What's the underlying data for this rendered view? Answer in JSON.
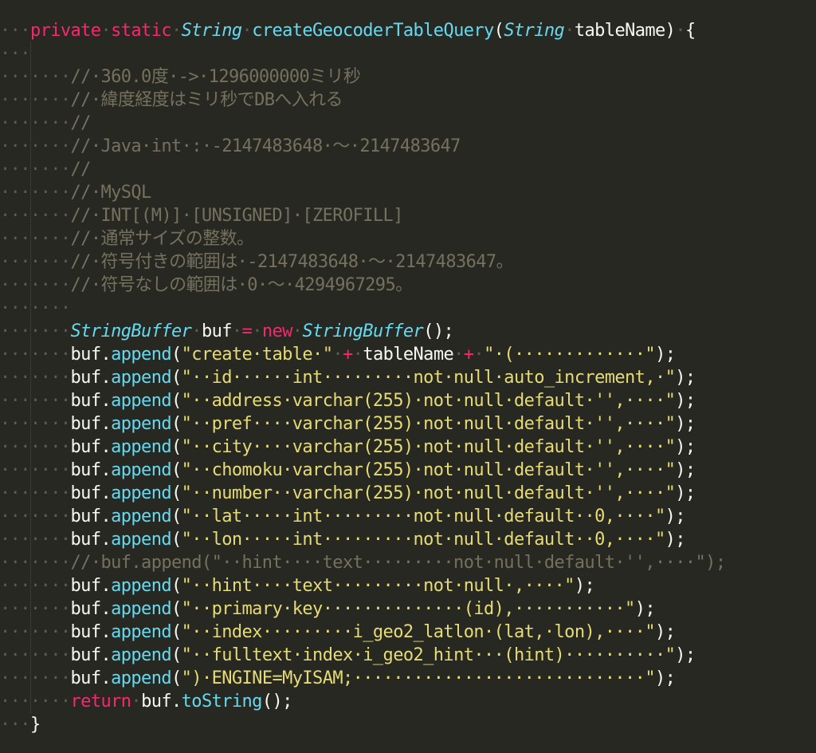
{
  "theme": {
    "background": "#272822",
    "foreground": "#F8F8F2",
    "keyword": "#F92672",
    "type": "#66D9EF",
    "function": "#A6E22E",
    "string": "#E6DB74",
    "comment": "#75715E",
    "whitespace_marker": "#5b5c52"
  },
  "editor": {
    "lines": [
      {
        "indent": "···",
        "tokens": [
          {
            "t": "private",
            "c": "keyword"
          },
          {
            "t": "·",
            "c": "ws"
          },
          {
            "t": "static",
            "c": "keyword"
          },
          {
            "t": "·",
            "c": "ws"
          },
          {
            "t": "String",
            "c": "type"
          },
          {
            "t": "·",
            "c": "ws"
          },
          {
            "t": "createGeocoderTableQuery",
            "c": "call"
          },
          {
            "t": "(",
            "c": "punct"
          },
          {
            "t": "String",
            "c": "type"
          },
          {
            "t": "·",
            "c": "ws"
          },
          {
            "t": "tableName",
            "c": "plain"
          },
          {
            "t": ")",
            "c": "punct"
          },
          {
            "t": "·",
            "c": "ws"
          },
          {
            "t": "{",
            "c": "punct"
          }
        ]
      },
      {
        "indent": "···",
        "tokens": []
      },
      {
        "indent": "·······",
        "tokens": [
          {
            "t": "//·360.0度·->·1296000000ミリ秒",
            "c": "comment"
          }
        ]
      },
      {
        "indent": "·······",
        "tokens": [
          {
            "t": "//·緯度経度はミリ秒でDBへ入れる",
            "c": "comment"
          }
        ]
      },
      {
        "indent": "·······",
        "tokens": [
          {
            "t": "//",
            "c": "comment"
          }
        ]
      },
      {
        "indent": "·······",
        "tokens": [
          {
            "t": "//·Java·int·:·-2147483648·〜·2147483647",
            "c": "comment"
          }
        ]
      },
      {
        "indent": "·······",
        "tokens": [
          {
            "t": "//",
            "c": "comment"
          }
        ]
      },
      {
        "indent": "·······",
        "tokens": [
          {
            "t": "//·MySQL",
            "c": "comment"
          }
        ]
      },
      {
        "indent": "·······",
        "tokens": [
          {
            "t": "//·INT[(M)]·[UNSIGNED]·[ZEROFILL]",
            "c": "comment"
          }
        ]
      },
      {
        "indent": "·······",
        "tokens": [
          {
            "t": "//·通常サイズの整数。",
            "c": "comment"
          }
        ]
      },
      {
        "indent": "·······",
        "tokens": [
          {
            "t": "//·符号付きの範囲は·-2147483648·〜·2147483647。",
            "c": "comment"
          }
        ]
      },
      {
        "indent": "·······",
        "tokens": [
          {
            "t": "//·符号なしの範囲は·0·〜·4294967295。",
            "c": "comment"
          }
        ]
      },
      {
        "indent": "·······",
        "tokens": []
      },
      {
        "indent": "·······",
        "tokens": [
          {
            "t": "StringBuffer",
            "c": "type"
          },
          {
            "t": "·",
            "c": "ws"
          },
          {
            "t": "buf",
            "c": "plain"
          },
          {
            "t": "·",
            "c": "ws"
          },
          {
            "t": "=",
            "c": "op"
          },
          {
            "t": "·",
            "c": "ws"
          },
          {
            "t": "new",
            "c": "keyword"
          },
          {
            "t": "·",
            "c": "ws"
          },
          {
            "t": "StringBuffer",
            "c": "type"
          },
          {
            "t": "();",
            "c": "punct"
          }
        ]
      },
      {
        "indent": "·······",
        "tokens": [
          {
            "t": "buf.",
            "c": "plain"
          },
          {
            "t": "append",
            "c": "call"
          },
          {
            "t": "(",
            "c": "punct"
          },
          {
            "t": "\"create·table·\"",
            "c": "string"
          },
          {
            "t": "·",
            "c": "ws"
          },
          {
            "t": "+",
            "c": "op"
          },
          {
            "t": "·",
            "c": "ws"
          },
          {
            "t": "tableName",
            "c": "plain"
          },
          {
            "t": "·",
            "c": "ws"
          },
          {
            "t": "+",
            "c": "op"
          },
          {
            "t": "·",
            "c": "ws"
          },
          {
            "t": "\"·(·············\"",
            "c": "string"
          },
          {
            "t": ");",
            "c": "punct"
          }
        ]
      },
      {
        "indent": "·······",
        "tokens": [
          {
            "t": "buf.",
            "c": "plain"
          },
          {
            "t": "append",
            "c": "call"
          },
          {
            "t": "(",
            "c": "punct"
          },
          {
            "t": "\"··id······int·········not·null·auto_increment,·\"",
            "c": "string"
          },
          {
            "t": ");",
            "c": "punct"
          }
        ]
      },
      {
        "indent": "·······",
        "tokens": [
          {
            "t": "buf.",
            "c": "plain"
          },
          {
            "t": "append",
            "c": "call"
          },
          {
            "t": "(",
            "c": "punct"
          },
          {
            "t": "\"··address·varchar(255)·not·null·default·'',····\"",
            "c": "string"
          },
          {
            "t": ");",
            "c": "punct"
          }
        ]
      },
      {
        "indent": "·······",
        "tokens": [
          {
            "t": "buf.",
            "c": "plain"
          },
          {
            "t": "append",
            "c": "call"
          },
          {
            "t": "(",
            "c": "punct"
          },
          {
            "t": "\"··pref····varchar(255)·not·null·default·'',····\"",
            "c": "string"
          },
          {
            "t": ");",
            "c": "punct"
          }
        ]
      },
      {
        "indent": "·······",
        "tokens": [
          {
            "t": "buf.",
            "c": "plain"
          },
          {
            "t": "append",
            "c": "call"
          },
          {
            "t": "(",
            "c": "punct"
          },
          {
            "t": "\"··city····varchar(255)·not·null·default·'',····\"",
            "c": "string"
          },
          {
            "t": ");",
            "c": "punct"
          }
        ]
      },
      {
        "indent": "·······",
        "tokens": [
          {
            "t": "buf.",
            "c": "plain"
          },
          {
            "t": "append",
            "c": "call"
          },
          {
            "t": "(",
            "c": "punct"
          },
          {
            "t": "\"··chomoku·varchar(255)·not·null·default·'',····\"",
            "c": "string"
          },
          {
            "t": ");",
            "c": "punct"
          }
        ]
      },
      {
        "indent": "·······",
        "tokens": [
          {
            "t": "buf.",
            "c": "plain"
          },
          {
            "t": "append",
            "c": "call"
          },
          {
            "t": "(",
            "c": "punct"
          },
          {
            "t": "\"··number··varchar(255)·not·null·default·'',····\"",
            "c": "string"
          },
          {
            "t": ");",
            "c": "punct"
          }
        ]
      },
      {
        "indent": "·······",
        "tokens": [
          {
            "t": "buf.",
            "c": "plain"
          },
          {
            "t": "append",
            "c": "call"
          },
          {
            "t": "(",
            "c": "punct"
          },
          {
            "t": "\"··lat·····int·········not·null·default··0,····\"",
            "c": "string"
          },
          {
            "t": ");",
            "c": "punct"
          }
        ]
      },
      {
        "indent": "·······",
        "tokens": [
          {
            "t": "buf.",
            "c": "plain"
          },
          {
            "t": "append",
            "c": "call"
          },
          {
            "t": "(",
            "c": "punct"
          },
          {
            "t": "\"··lon·····int·········not·null·default··0,····\"",
            "c": "string"
          },
          {
            "t": ");",
            "c": "punct"
          }
        ]
      },
      {
        "indent": "·······",
        "tokens": [
          {
            "t": "//·buf.append(\"··hint····text·········not·null·default·'',····\");",
            "c": "comment"
          }
        ]
      },
      {
        "indent": "·······",
        "tokens": [
          {
            "t": "buf.",
            "c": "plain"
          },
          {
            "t": "append",
            "c": "call"
          },
          {
            "t": "(",
            "c": "punct"
          },
          {
            "t": "\"··hint····text·········not·null·,····\"",
            "c": "string"
          },
          {
            "t": ");",
            "c": "punct"
          }
        ]
      },
      {
        "indent": "·······",
        "tokens": [
          {
            "t": "buf.",
            "c": "plain"
          },
          {
            "t": "append",
            "c": "call"
          },
          {
            "t": "(",
            "c": "punct"
          },
          {
            "t": "\"··primary·key··············(id),···········\"",
            "c": "string"
          },
          {
            "t": ");",
            "c": "punct"
          }
        ]
      },
      {
        "indent": "·······",
        "tokens": [
          {
            "t": "buf.",
            "c": "plain"
          },
          {
            "t": "append",
            "c": "call"
          },
          {
            "t": "(",
            "c": "punct"
          },
          {
            "t": "\"··index·········i_geo2_latlon·(lat,·lon),····\"",
            "c": "string"
          },
          {
            "t": ");",
            "c": "punct"
          }
        ]
      },
      {
        "indent": "·······",
        "tokens": [
          {
            "t": "buf.",
            "c": "plain"
          },
          {
            "t": "append",
            "c": "call"
          },
          {
            "t": "(",
            "c": "punct"
          },
          {
            "t": "\"··fulltext·index·i_geo2_hint···(hint)··········\"",
            "c": "string"
          },
          {
            "t": ");",
            "c": "punct"
          }
        ]
      },
      {
        "indent": "·······",
        "tokens": [
          {
            "t": "buf.",
            "c": "plain"
          },
          {
            "t": "append",
            "c": "call"
          },
          {
            "t": "(",
            "c": "punct"
          },
          {
            "t": "\")·ENGINE=MyISAM;·····························\"",
            "c": "string"
          },
          {
            "t": ");",
            "c": "punct"
          }
        ]
      },
      {
        "indent": "·······",
        "tokens": [
          {
            "t": "return",
            "c": "keyword"
          },
          {
            "t": "·",
            "c": "ws"
          },
          {
            "t": "buf.",
            "c": "plain"
          },
          {
            "t": "toString",
            "c": "call"
          },
          {
            "t": "();",
            "c": "punct"
          }
        ]
      },
      {
        "indent": "···",
        "tokens": [
          {
            "t": "}",
            "c": "punct"
          }
        ]
      }
    ]
  }
}
